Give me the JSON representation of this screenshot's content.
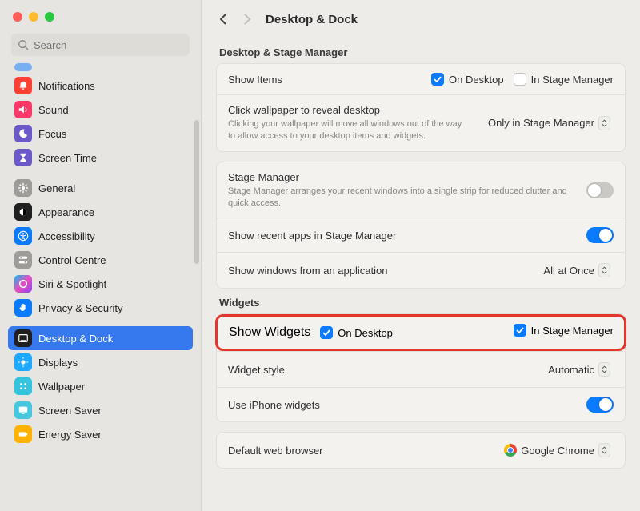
{
  "search": {
    "placeholder": "Search"
  },
  "header": {
    "title": "Desktop & Dock"
  },
  "colors": {
    "accent": "#0a7aff",
    "highlight": "#e4372b"
  },
  "sidebar": {
    "items": [
      {
        "label": "Notifications",
        "icon": "bell-icon",
        "bg": "#ff4034"
      },
      {
        "label": "Sound",
        "icon": "speaker-icon",
        "bg": "#ff3869"
      },
      {
        "label": "Focus",
        "icon": "moon-icon",
        "bg": "#6b58c9"
      },
      {
        "label": "Screen Time",
        "icon": "hourglass-icon",
        "bg": "#6b58c9"
      },
      {
        "label": "General",
        "icon": "gear-icon",
        "bg": "#9d9c99"
      },
      {
        "label": "Appearance",
        "icon": "appearance-icon",
        "bg": "#1f1f1f"
      },
      {
        "label": "Accessibility",
        "icon": "accessibility-icon",
        "bg": "#0a7aff"
      },
      {
        "label": "Control Centre",
        "icon": "switches-icon",
        "bg": "#9d9c99"
      },
      {
        "label": "Siri & Spotlight",
        "icon": "siri-icon",
        "bg": "linear-gradient(135deg,#0bbbef,#e84fbe,#8a42f0)"
      },
      {
        "label": "Privacy & Security",
        "icon": "hand-icon",
        "bg": "#0a7aff"
      },
      {
        "label": "Desktop & Dock",
        "icon": "dock-icon",
        "bg": "#1f1f1f",
        "active": true
      },
      {
        "label": "Displays",
        "icon": "displays-icon",
        "bg": "#1ea7ff"
      },
      {
        "label": "Wallpaper",
        "icon": "wallpaper-icon",
        "bg": "#34c4de"
      },
      {
        "label": "Screen Saver",
        "icon": "screensaver-icon",
        "bg": "#46c7e0"
      },
      {
        "label": "Energy Saver",
        "icon": "battery-icon",
        "bg": "#ffb300"
      }
    ]
  },
  "section1": {
    "title": "Desktop & Stage Manager",
    "showItemsLabel": "Show Items",
    "onDesktop": "On Desktop",
    "inStageManager": "In Stage Manager",
    "clickWallpaperLabel": "Click wallpaper to reveal desktop",
    "clickWallpaperDesc": "Clicking your wallpaper will move all windows out of the way to allow access to your desktop items and widgets.",
    "clickWallpaperValue": "Only in Stage Manager"
  },
  "section2": {
    "stageManagerLabel": "Stage Manager",
    "stageManagerDesc": "Stage Manager arranges your recent windows into a single strip for reduced clutter and quick access.",
    "showRecentLabel": "Show recent apps in Stage Manager",
    "showWindowsLabel": "Show windows from an application",
    "showWindowsValue": "All at Once"
  },
  "widgets": {
    "title": "Widgets",
    "showWidgetsLabel": "Show Widgets",
    "onDesktop": "On Desktop",
    "inStageManager": "In Stage Manager",
    "widgetStyleLabel": "Widget style",
    "widgetStyleValue": "Automatic",
    "useIphoneLabel": "Use iPhone widgets"
  },
  "browser": {
    "label": "Default web browser",
    "value": "Google Chrome"
  }
}
